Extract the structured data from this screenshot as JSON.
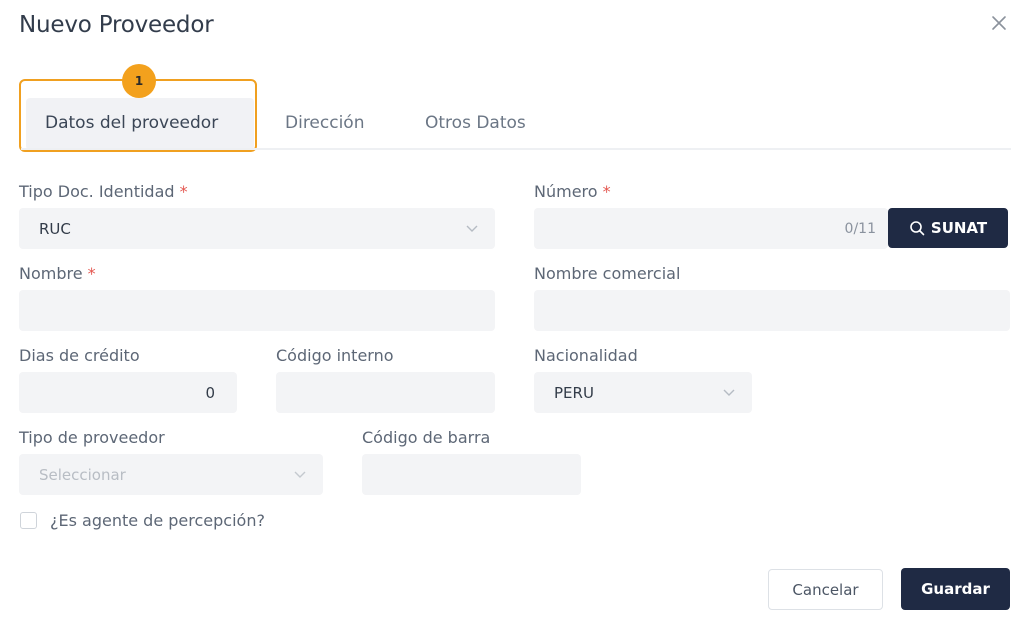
{
  "dialog": {
    "title": "Nuevo Proveedor"
  },
  "highlight": {
    "badge": "1"
  },
  "tabs": [
    {
      "label": "Datos del proveedor",
      "active": true
    },
    {
      "label": "Dirección",
      "active": false
    },
    {
      "label": "Otros Datos",
      "active": false
    }
  ],
  "form": {
    "tipo_doc": {
      "label": "Tipo Doc. Identidad",
      "required_mark": "*",
      "value": "RUC"
    },
    "numero": {
      "label": "Número",
      "required_mark": "*",
      "value": "",
      "counter": "0/11"
    },
    "sunat_button": {
      "label": "SUNAT"
    },
    "nombre": {
      "label": "Nombre",
      "required_mark": "*",
      "value": ""
    },
    "nombre_comercial": {
      "label": "Nombre comercial",
      "value": ""
    },
    "dias_credito": {
      "label": "Dias de crédito",
      "value": "0"
    },
    "codigo_interno": {
      "label": "Código interno",
      "value": ""
    },
    "nacionalidad": {
      "label": "Nacionalidad",
      "value": "PERU"
    },
    "tipo_proveedor": {
      "label": "Tipo de proveedor",
      "placeholder": "Seleccionar"
    },
    "codigo_barra": {
      "label": "Código de barra",
      "value": ""
    },
    "agente_percepcion": {
      "label": "¿Es agente de percepción?",
      "checked": false
    }
  },
  "footer": {
    "cancel_label": "Cancelar",
    "save_label": "Guardar"
  },
  "colors": {
    "primary": "#1f2a44",
    "highlight": "#f0a020",
    "required": "#e4564f",
    "field_bg": "#f3f4f6"
  }
}
